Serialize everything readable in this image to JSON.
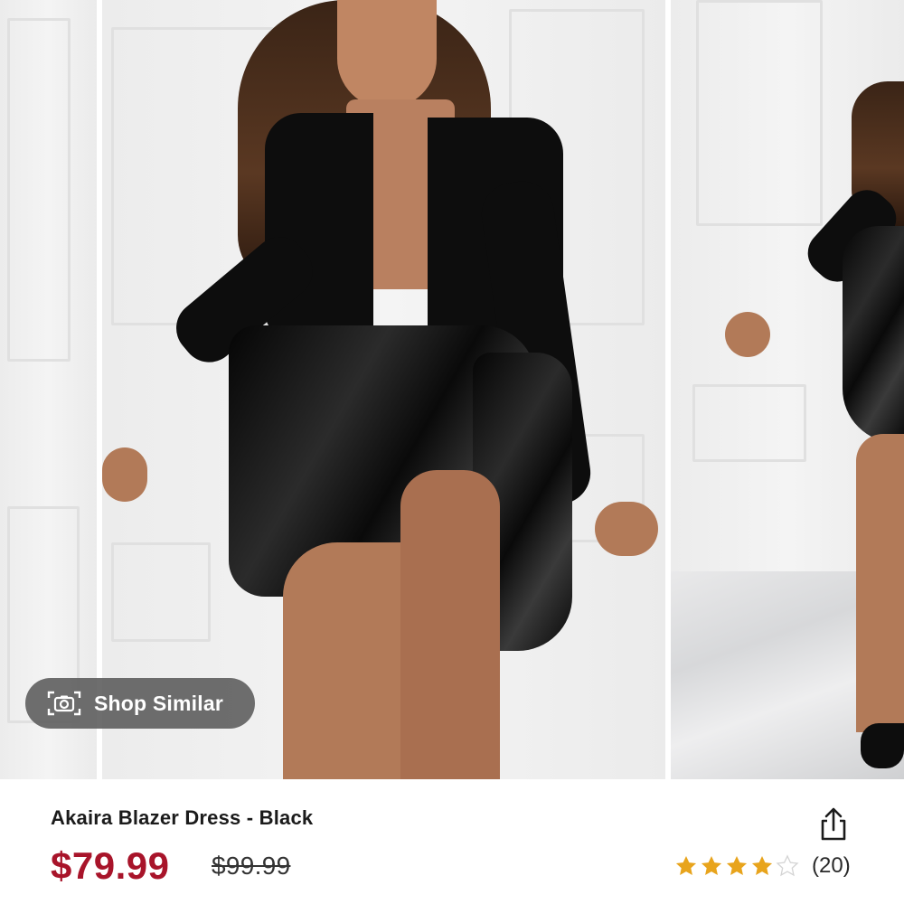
{
  "carousel": {
    "shop_similar_label": "Shop Similar",
    "icons": {
      "shop_similar": "camera-scan-icon"
    }
  },
  "product": {
    "title": "Akaira Blazer Dress - Black",
    "price": "$79.99",
    "original_price": "$99.99",
    "rating": {
      "stars": 4,
      "max_stars": 5,
      "review_count_label": "(20)"
    }
  },
  "icons": {
    "share": "share-icon",
    "star": "star-icon"
  },
  "colors": {
    "price": "#a8142a",
    "star_filled": "#e8a41c",
    "star_empty": "#d4d4d4",
    "pill_bg": "#5a5a5a"
  }
}
